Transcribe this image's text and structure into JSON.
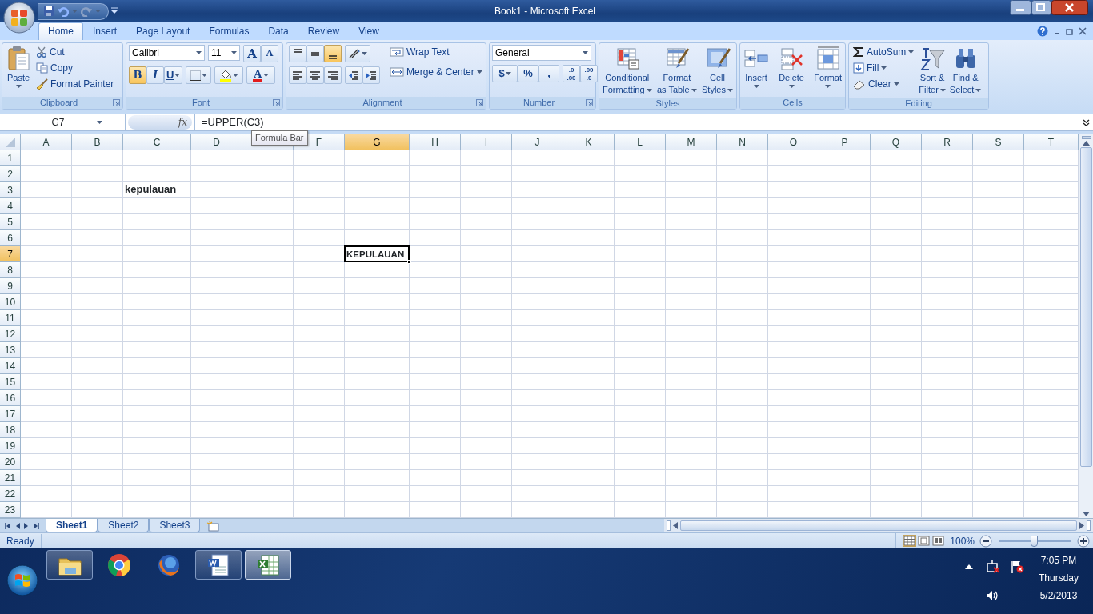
{
  "window": {
    "title": "Book1 - Microsoft Excel"
  },
  "ribbon": {
    "tabs": [
      {
        "label": "Home",
        "selected": true
      },
      {
        "label": "Insert",
        "selected": false
      },
      {
        "label": "Page Layout",
        "selected": false
      },
      {
        "label": "Formulas",
        "selected": false
      },
      {
        "label": "Data",
        "selected": false
      },
      {
        "label": "Review",
        "selected": false
      },
      {
        "label": "View",
        "selected": false
      }
    ],
    "groups": [
      {
        "kind": "clipboard",
        "label": "Clipboard",
        "paste": "Paste",
        "items": [
          "Cut",
          "Copy",
          "Format Painter"
        ]
      },
      {
        "kind": "font",
        "label": "Font",
        "font_name": "Calibri",
        "font_size": "11",
        "grow": "A",
        "shrink": "A",
        "toggles": [
          {
            "label": "B",
            "selected": true
          },
          {
            "label": "I",
            "selected": false
          },
          {
            "label": "U",
            "selected": false
          }
        ],
        "font_color": "A"
      },
      {
        "kind": "alignment",
        "label": "Alignment",
        "vertical": [
          {
            "selected": false
          },
          {
            "selected": false
          },
          {
            "selected": true
          }
        ],
        "horizontal": [
          {
            "selected": false
          },
          {
            "selected": false
          },
          {
            "selected": false
          }
        ],
        "wrap": "Wrap Text",
        "merge": "Merge & Center"
      },
      {
        "kind": "number",
        "label": "Number",
        "format": "General",
        "symbols": [
          "$",
          "%",
          ","
        ],
        "decimals": [
          {
            "top": ".0",
            "bottom": ".00"
          },
          {
            "top": ".00",
            "bottom": ".0"
          }
        ]
      },
      {
        "kind": "styles",
        "label": "Styles",
        "buttons": [
          [
            "Conditional",
            "Formatting"
          ],
          [
            "Format",
            "as Table"
          ],
          [
            "Cell",
            "Styles"
          ]
        ]
      },
      {
        "kind": "cells",
        "label": "Cells",
        "buttons": [
          [
            "Insert"
          ],
          [
            "Delete"
          ],
          [
            "Format"
          ]
        ]
      },
      {
        "kind": "editing",
        "label": "Editing",
        "items": [
          "AutoSum",
          "Fill",
          "Clear"
        ],
        "buttons": [
          [
            "Sort &",
            "Filter"
          ],
          [
            "Find &",
            "Select"
          ]
        ]
      }
    ]
  },
  "formula_bar": {
    "name_box": "G7",
    "fx": "fx",
    "formula": "=UPPER(C3)",
    "tooltip": "Formula Bar"
  },
  "grid": {
    "columns": [
      {
        "label": "A",
        "selected": false
      },
      {
        "label": "B",
        "selected": false
      },
      {
        "label": "C",
        "selected": false
      },
      {
        "label": "D",
        "selected": false
      },
      {
        "selected": false
      },
      {
        "label": "F",
        "selected": false
      },
      {
        "label": "G",
        "selected": true
      },
      {
        "label": "H",
        "selected": false
      },
      {
        "label": "I",
        "selected": false
      },
      {
        "label": "J",
        "selected": false
      },
      {
        "label": "K",
        "selected": false
      },
      {
        "label": "L",
        "selected": false
      },
      {
        "label": "M",
        "selected": false
      },
      {
        "label": "N",
        "selected": false
      },
      {
        "label": "O",
        "selected": false
      },
      {
        "label": "P",
        "selected": false
      },
      {
        "label": "Q",
        "selected": false
      },
      {
        "label": "R",
        "selected": false
      },
      {
        "label": "S",
        "selected": false
      },
      {
        "label": "T",
        "selected": false
      }
    ],
    "rows": [
      {
        "label": "1",
        "selected": false
      },
      {
        "label": "2",
        "selected": false
      },
      {
        "label": "3",
        "selected": false,
        "cells": [
          {},
          {},
          {
            "text": "kepulauan",
            "selected": false
          }
        ]
      },
      {
        "label": "4",
        "selected": false
      },
      {
        "label": "5",
        "selected": false
      },
      {
        "label": "6",
        "selected": false
      },
      {
        "label": "7",
        "selected": true,
        "cells": [
          {},
          {},
          {},
          {},
          {},
          {},
          {
            "text": "KEPULAUAN",
            "selected": true
          }
        ]
      },
      {
        "label": "8",
        "selected": false
      },
      {
        "label": "9",
        "selected": false
      },
      {
        "label": "10",
        "selected": false
      },
      {
        "label": "11",
        "selected": false
      },
      {
        "label": "12",
        "selected": false
      },
      {
        "label": "13",
        "selected": false
      },
      {
        "label": "14",
        "selected": false
      },
      {
        "label": "15",
        "selected": false
      },
      {
        "label": "16",
        "selected": false
      },
      {
        "label": "17",
        "selected": false
      },
      {
        "label": "18",
        "selected": false
      },
      {
        "label": "19",
        "selected": false
      },
      {
        "label": "20",
        "selected": false
      },
      {
        "label": "21",
        "selected": false
      },
      {
        "label": "22",
        "selected": false
      },
      {
        "label": "23",
        "selected": false
      }
    ]
  },
  "sheets": [
    {
      "label": "Sheet1",
      "selected": true
    },
    {
      "label": "Sheet2",
      "selected": false
    },
    {
      "label": "Sheet3",
      "selected": false
    }
  ],
  "status_bar": {
    "text": "Ready",
    "views": [
      {
        "selected": true
      },
      {
        "selected": false
      },
      {
        "selected": false
      }
    ],
    "zoom": "100%",
    "zoom_slider": {
      "level": 0.5
    }
  },
  "taskbar": {
    "apps": [
      {
        "kind": "folder",
        "running": true,
        "selected": false
      },
      {
        "kind": "ring",
        "running": false,
        "selected": false
      },
      {
        "kind": "globe",
        "running": false,
        "selected": false
      },
      {
        "kind": "document",
        "running": true,
        "selected": false
      },
      {
        "kind": "spreadsheet",
        "running": true,
        "selected": true
      }
    ],
    "time": "7:05 PM",
    "day": "Thursday",
    "date": "5/2/2013"
  }
}
